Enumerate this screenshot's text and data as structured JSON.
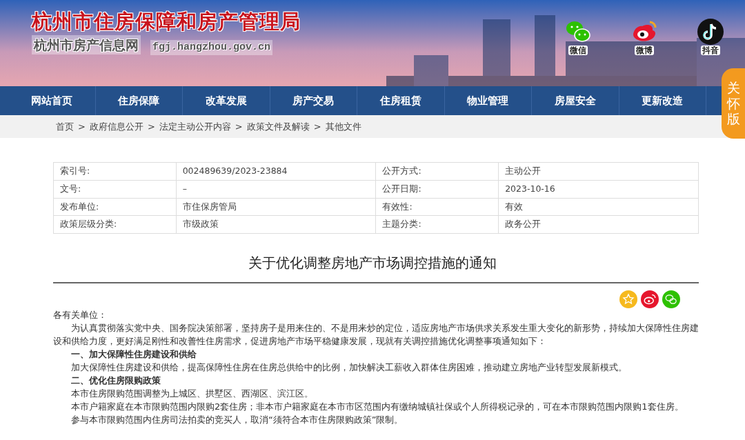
{
  "header": {
    "title": "杭州市住房保障和房产管理局",
    "subtitle": "杭州市房产信息网",
    "domain": "fgj.hangzhou.gov.cn",
    "social": [
      {
        "kind": "wechat",
        "label": "微信"
      },
      {
        "kind": "weibo",
        "label": "微博"
      },
      {
        "kind": "douyin",
        "label": "抖音"
      }
    ]
  },
  "care_button": "关怀版",
  "nav": [
    "网站首页",
    "住房保障",
    "改革发展",
    "房产交易",
    "住房租赁",
    "物业管理",
    "房屋安全",
    "更新改造"
  ],
  "breadcrumb": {
    "separator": ">",
    "items": [
      "首页",
      "政府信息公开",
      "法定主动公开内容",
      "政策文件及解读",
      "其他文件"
    ]
  },
  "meta_table": [
    [
      "索引号:",
      "002489639/2023-23884",
      "公开方式:",
      "主动公开"
    ],
    [
      "文号:",
      "–",
      "公开日期:",
      "2023-10-16"
    ],
    [
      "发布单位:",
      "市住保房管局",
      "有效性:",
      "有效"
    ],
    [
      "政策层级分类:",
      "市级政策",
      "主题分类:",
      "政务公开"
    ]
  ],
  "article_title": "关于优化调整房地产市场调控措施的通知",
  "share": [
    {
      "kind": "favorite"
    },
    {
      "kind": "weibo"
    },
    {
      "kind": "wechat"
    }
  ],
  "paragraphs": [
    {
      "kind": "salutation",
      "text": "各有关单位："
    },
    {
      "kind": "body",
      "text": "为认真贯彻落实党中央、国务院决策部署，坚持房子是用来住的、不是用来炒的定位，适应房地产市场供求关系发生重大变化的新形势，持续加大保障性住房建设和供给力度，更好满足刚性和改善性住房需求，促进房地产市场平稳健康发展，现就有关调控措施优化调整事项通知如下："
    },
    {
      "kind": "heading",
      "text": "一、加大保障性住房建设和供给"
    },
    {
      "kind": "body",
      "text": "加大保障性住房建设和供给，提高保障性住房在住房总供给中的比例，加快解决工薪收入群体住房困难，推动建立房地产业转型发展新模式。"
    },
    {
      "kind": "heading",
      "text": "二、优化住房限购政策"
    },
    {
      "kind": "body",
      "text": "本市住房限购范围调整为上城区、拱墅区、西湖区、滨江区。"
    },
    {
      "kind": "body",
      "text": "本市户籍家庭在本市限购范围内限购2套住房；非本市户籍家庭在本市市区范围内有缴纳城镇社保或个人所得税记录的，可在本市限购范围内限购1套住房。"
    },
    {
      "kind": "body",
      "text": "参与本市限购范围内住房司法拍卖的竞买人，取消“须符合本市住房限购政策”限制。"
    }
  ]
}
